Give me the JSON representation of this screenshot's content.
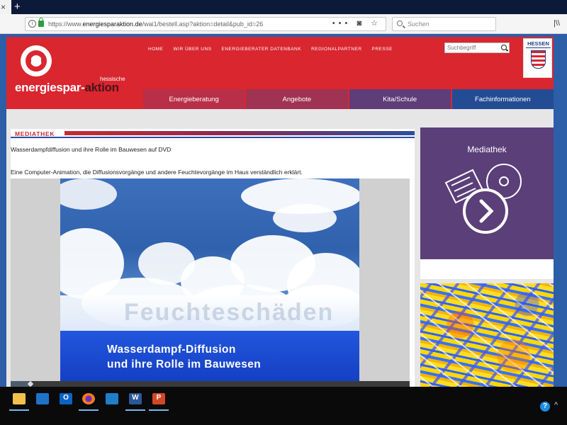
{
  "browser": {
    "close_tab_glyph": "×",
    "new_tab_glyph": "+",
    "url_prefix": "https://www.",
    "url_domain": "energiesparaktion.de",
    "url_path": "/wai1/bestell.asp?aktion=detail&pub_id=26",
    "url_actions": "••• ◙ ☆",
    "search_placeholder": "Suchen",
    "library_glyph": "|\\\\"
  },
  "site": {
    "logo_prefix": "hessische",
    "logo_word_main": "energiespar-",
    "logo_word_accent": "aktion",
    "top_nav": [
      "HOME",
      "WIR ÜBER UNS",
      "ENERGIEBERATER DATENBANK",
      "REGIONALPARTNER",
      "PRESSE"
    ],
    "search_placeholder": "Suchbegriff",
    "state_label": "HESSEN",
    "main_nav": [
      "Energieberatung",
      "Angebote",
      "Kita/Schule",
      "Fachinformationen"
    ]
  },
  "content": {
    "section_label": "MEDIATHEK",
    "pub_title": "Wasserdampfdiffusion und ihre Rolle im Bauwesen auf DVD",
    "pub_description": "Eine Computer-Animation, die Diffusionsvorgänge und andere Feuchtevorgänge im Haus verständlich erklärt.",
    "video": {
      "watermark": "Feuchteschäden",
      "title_line_1": "Wasserdampf-Diffusion",
      "title_line_2": "und ihre Rolle im Bauwesen",
      "progress_fraction": 0.05
    }
  },
  "sidebar": {
    "card_title": "Mediathek",
    "card_icon": "book-disc-play-icon"
  },
  "taskbar": {
    "apps": [
      {
        "name": "file-explorer",
        "active": true
      },
      {
        "name": "store",
        "active": false
      },
      {
        "name": "outlook",
        "letter": "O",
        "active": false
      },
      {
        "name": "firefox",
        "active": true
      },
      {
        "name": "file-app",
        "active": false
      },
      {
        "name": "word",
        "letter": "W",
        "active": true
      },
      {
        "name": "powerpoint",
        "letter": "P",
        "active": true
      }
    ],
    "help_glyph": "?",
    "chevron_glyph": "^"
  },
  "colors": {
    "header_red": "#d9262f",
    "nav_purple": "#5e3d79",
    "nav_blue": "#244c94",
    "sidebar_purple": "#5b3f79"
  }
}
